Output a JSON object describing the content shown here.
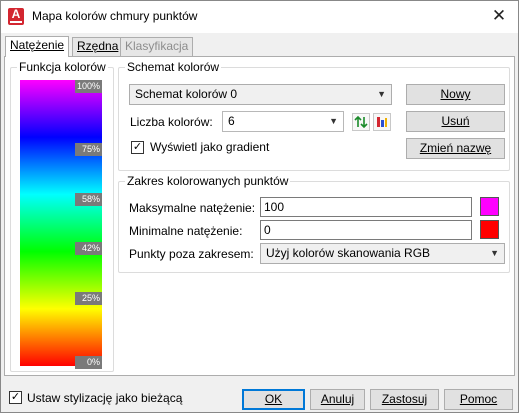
{
  "window": {
    "title": "Mapa kolorów chmury punktów",
    "close_glyph": "✕"
  },
  "tabs": [
    {
      "label": "Natężenie",
      "state": "active"
    },
    {
      "label": "Rzędna",
      "state": "normal"
    },
    {
      "label": "Klasyfikacja",
      "state": "disabled"
    }
  ],
  "color_function": {
    "title": "Funkcja kolorów",
    "gradient_colors": [
      "#ff00ff",
      "#0000ff",
      "#00ffff",
      "#00ff00",
      "#ffff00",
      "#ff0000"
    ],
    "levels": [
      "100%",
      "75%",
      "58%",
      "42%",
      "25%",
      "0%"
    ]
  },
  "scheme": {
    "title": "Schemat kolorów",
    "selected": "Schemat kolorów 0",
    "count_label": "Liczba kolorów:",
    "count_value": "6",
    "gradient_checkbox_label": "Wyświetl jako gradient",
    "gradient_checked": true,
    "new_button": "Nowy",
    "delete_button": "Usuń",
    "rename_button": "Zmień nazwę"
  },
  "range": {
    "title": "Zakres kolorowanych punktów",
    "max_label": "Maksymalne natężenie:",
    "max_value": "100",
    "max_color": "#ff00ff",
    "min_label": "Minimalne natężenie:",
    "min_value": "0",
    "min_color": "#ff0000",
    "outside_label": "Punkty poza zakresem:",
    "outside_value": "Użyj kolorów skanowania RGB"
  },
  "footer": {
    "set_current_label": "Ustaw stylizację jako bieżącą",
    "set_current_checked": true,
    "ok": "OK",
    "cancel": "Anuluj",
    "apply": "Zastosuj",
    "help": "Pomoc"
  }
}
